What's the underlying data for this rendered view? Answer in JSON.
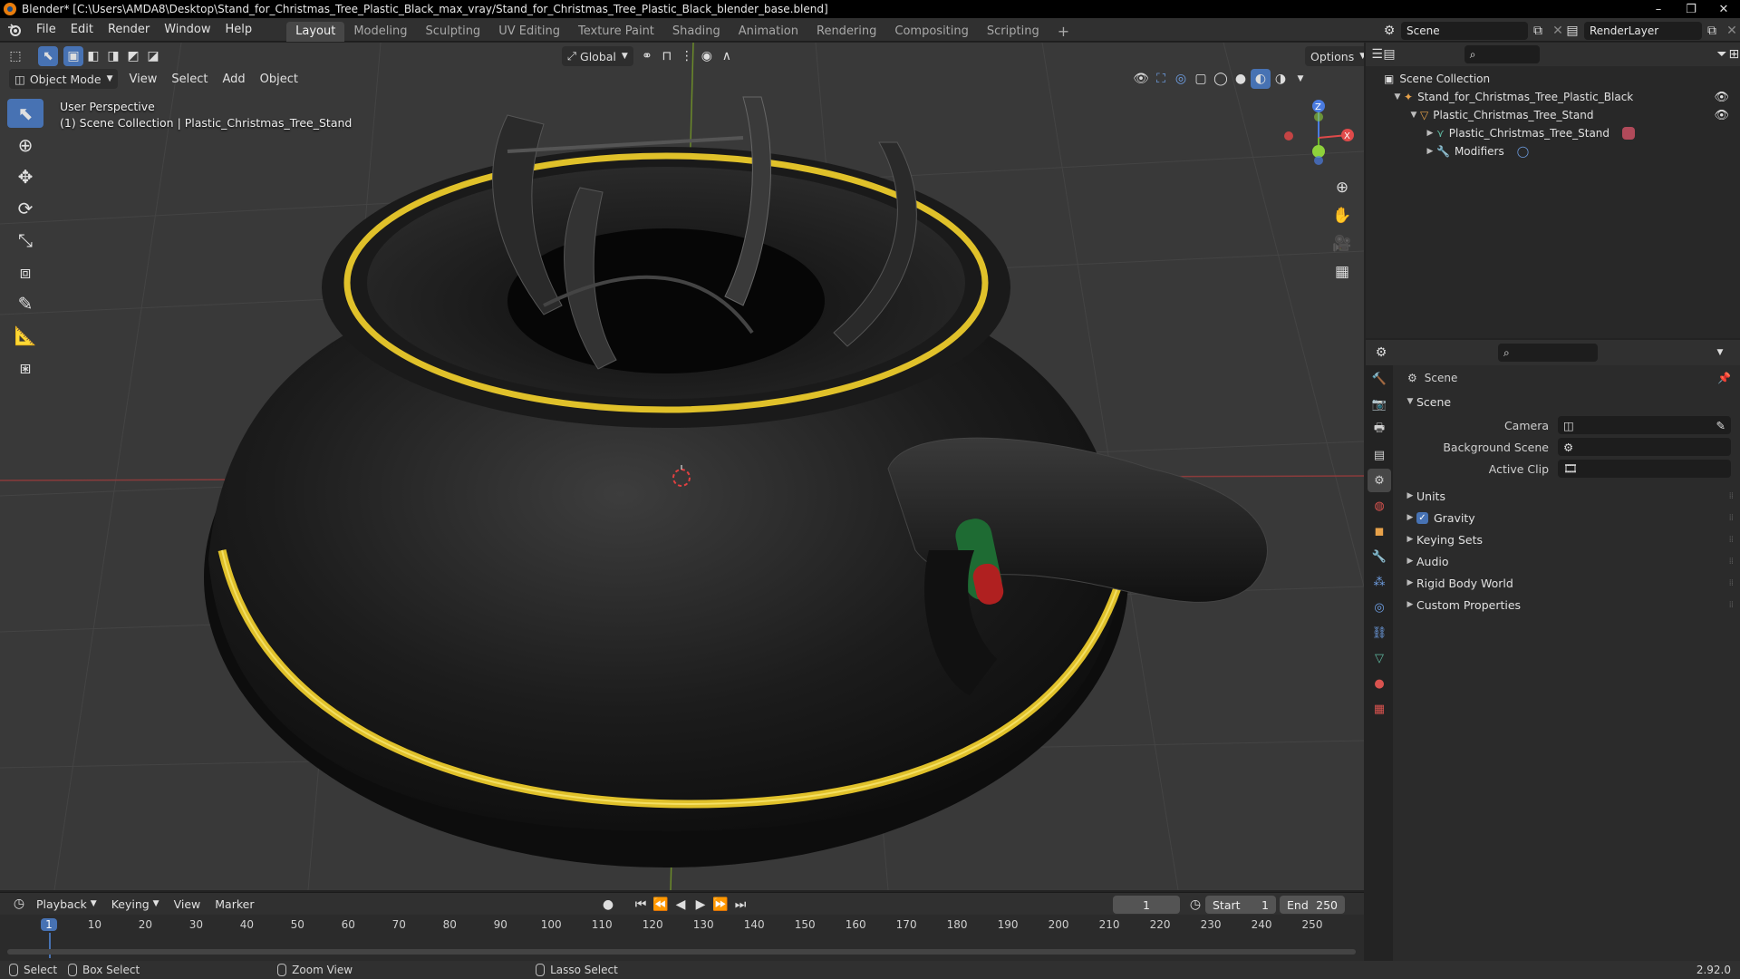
{
  "window": {
    "title": "Blender* [C:\\Users\\AMDA8\\Desktop\\Stand_for_Christmas_Tree_Plastic_Black_max_vray/Stand_for_Christmas_Tree_Plastic_Black_blender_base.blend]",
    "controls": [
      "–",
      "❐",
      "✕"
    ]
  },
  "menubar": {
    "menus": [
      "File",
      "Edit",
      "Render",
      "Window",
      "Help"
    ],
    "workspaces": [
      "Layout",
      "Modeling",
      "Sculpting",
      "UV Editing",
      "Texture Paint",
      "Shading",
      "Animation",
      "Rendering",
      "Compositing",
      "Scripting"
    ],
    "active_workspace": "Layout",
    "add_workspace": "+",
    "scene": "Scene",
    "view_layer": "RenderLayer"
  },
  "viewport": {
    "transform_orientation": "Global",
    "options_label": "Options",
    "mode": "Object Mode",
    "menus": [
      "View",
      "Select",
      "Add",
      "Object"
    ],
    "overlay_line1": "User Perspective",
    "overlay_line2": "(1) Scene Collection | Plastic_Christmas_Tree_Stand",
    "gizmo": {
      "z": "Z",
      "y": "Y",
      "x": "X"
    },
    "colors": {
      "background": "#393939",
      "grid": "#454545",
      "x_axis": "#8a3b3b",
      "y_axis": "#6b8a2a",
      "accent": "#4772b3",
      "trim": "#e0c12a"
    }
  },
  "timeline": {
    "menus": [
      "Playback",
      "Keying",
      "View",
      "Marker"
    ],
    "current_frame": "1",
    "start_label": "Start",
    "start": "1",
    "end_label": "End",
    "end": "250",
    "ticks": [
      "1",
      "10",
      "20",
      "30",
      "40",
      "50",
      "60",
      "70",
      "80",
      "90",
      "100",
      "110",
      "120",
      "130",
      "140",
      "150",
      "160",
      "170",
      "180",
      "190",
      "200",
      "210",
      "220",
      "230",
      "240",
      "250"
    ]
  },
  "statusbar": {
    "items": [
      "Select",
      "Box Select",
      "Zoom View",
      "Lasso Select"
    ],
    "version": "2.92.0"
  },
  "outliner": {
    "root": "Scene Collection",
    "rows": [
      {
        "label": "Stand_for_Christmas_Tree_Plastic_Black",
        "icon": "armature-icon"
      },
      {
        "label": "Plastic_Christmas_Tree_Stand",
        "icon": "object-icon"
      },
      {
        "label": "Plastic_Christmas_Tree_Stand",
        "icon": "mesh-icon"
      },
      {
        "label": "Modifiers",
        "icon": "wrench-icon"
      }
    ]
  },
  "properties": {
    "context": "Scene",
    "panel_title": "Scene",
    "fields": [
      {
        "label": "Camera",
        "value": ""
      },
      {
        "label": "Background Scene",
        "value": ""
      },
      {
        "label": "Active Clip",
        "value": ""
      }
    ],
    "subpanels": [
      "Units",
      "Gravity",
      "Keying Sets",
      "Audio",
      "Rigid Body World",
      "Custom Properties"
    ]
  }
}
